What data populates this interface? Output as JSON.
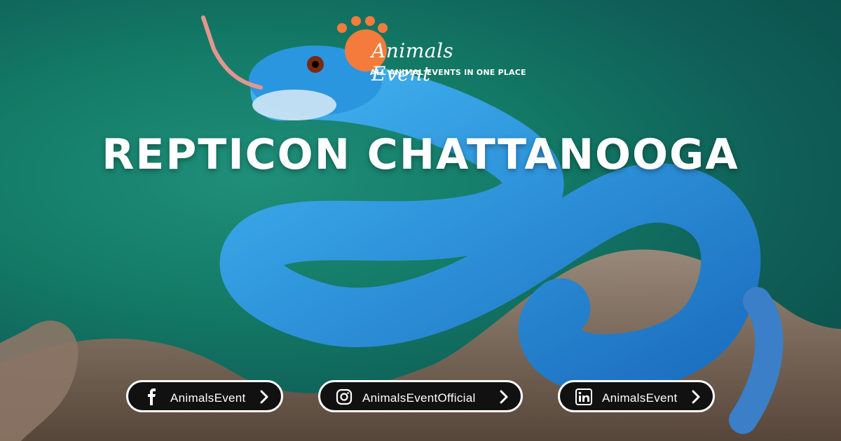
{
  "brand": {
    "name": "Animals Event",
    "tagline": "ALL ANIMAL EVENTS IN ONE PLACE",
    "accent_color": "#F47B3B"
  },
  "event": {
    "title": "REPTICON CHATTANOOGA"
  },
  "social": [
    {
      "network": "facebook",
      "icon": "facebook-icon",
      "label": "AnimalsEvent"
    },
    {
      "network": "instagram",
      "icon": "instagram-icon",
      "label": "AnimalsEventOfficial"
    },
    {
      "network": "linkedin",
      "icon": "linkedin-icon",
      "label": "AnimalsEvent"
    }
  ],
  "colors": {
    "background": "#137A66",
    "snake": "#2A8FD8",
    "pill_bg": "#111111",
    "text": "#FFFFFF"
  }
}
